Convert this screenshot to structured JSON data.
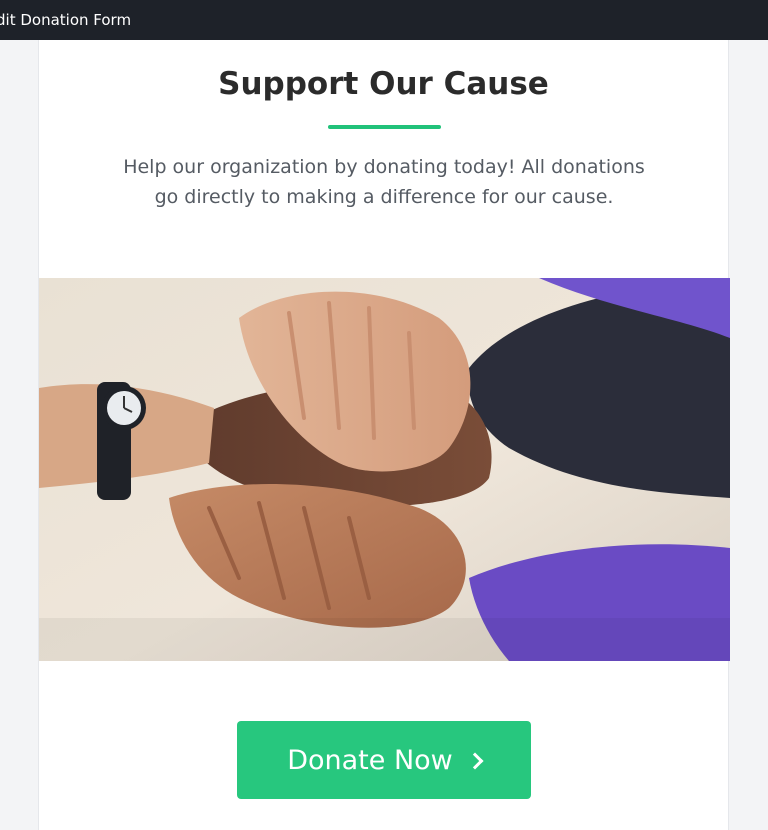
{
  "window": {
    "title": "dit Donation Form"
  },
  "campaign": {
    "heading": "Support Our Cause",
    "description": "Help our organization by donating today! All donations go directly to making a difference for our cause."
  },
  "hero_image": {
    "subject": "stacked-hands-photo"
  },
  "cta": {
    "label": "Donate Now",
    "icon": "chevron-right-icon"
  },
  "colors": {
    "topbar_bg": "#1e2229",
    "accent": "#27c77e",
    "divider": "#21c27a",
    "heading_text": "#2b2b2b",
    "body_text": "#555b63"
  }
}
